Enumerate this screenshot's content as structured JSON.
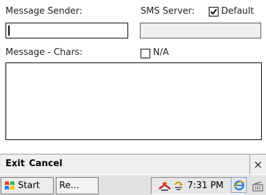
{
  "form": {
    "sender_label": "Message Sender:",
    "sender_value": "",
    "server_label": "SMS Server:",
    "default_label": "Default",
    "default_checked": true,
    "server_value": "",
    "message_label": "Message - Chars:",
    "na_label": "N/A",
    "na_checked": false,
    "message_value": ""
  },
  "command_bar": {
    "exit_label": "Exit",
    "cancel_label": "Cancel",
    "close_glyph": "×"
  },
  "taskbar": {
    "start_label": "Start",
    "app_label": "Re...",
    "clock": "7:31 PM"
  },
  "icons": {
    "start": "windows-flag-icon",
    "tray_network": "network-icon",
    "tray_sync": "sync-icon",
    "tray_ie": "internet-explorer-icon",
    "tray_keyboard": "keyboard-icon"
  }
}
